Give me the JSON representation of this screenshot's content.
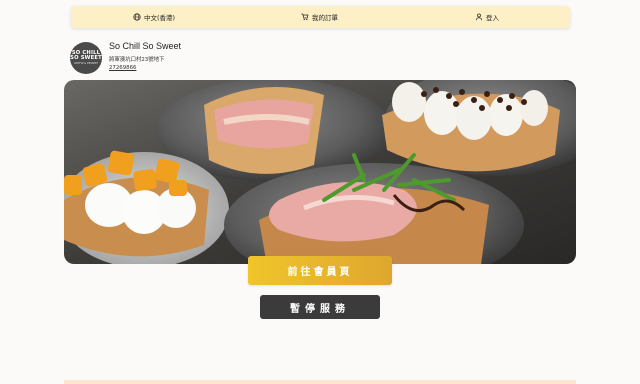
{
  "nav": {
    "language": "中文(香港)",
    "orders": "我的訂單",
    "login": "登入"
  },
  "shop": {
    "name": "So Chill So Sweet",
    "address": "將軍澳坑口村23號地下",
    "phone": "27269866",
    "logo": {
      "line1": "SO CHILL",
      "line2": "SO SWEET",
      "line3": "WAFFLE & DESSERT"
    }
  },
  "actions": {
    "member_label": "前往會員頁",
    "pause_label": "暫停服務"
  },
  "colors": {
    "topbar": "#fdf0c6",
    "member_button": "#e9b62c",
    "pause_button": "#3b3b3b",
    "logo_bg": "#4b4a4a"
  },
  "icons": {
    "language": "globe-icon",
    "orders": "cart-icon",
    "login": "user-icon"
  }
}
